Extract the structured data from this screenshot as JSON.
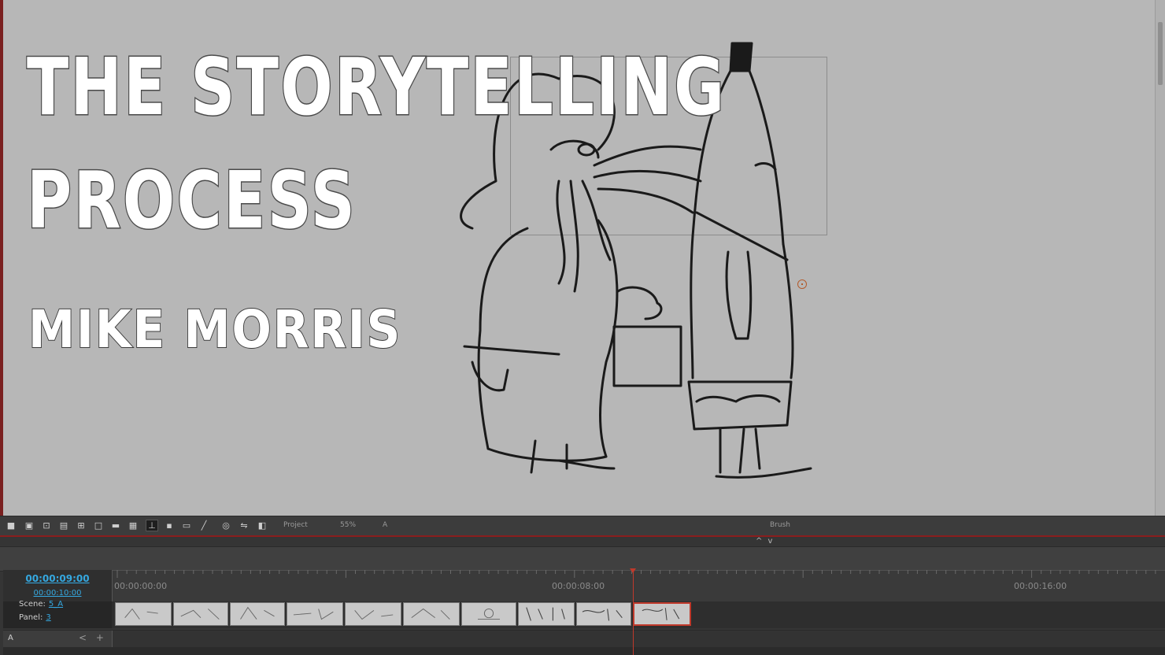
{
  "title": {
    "line1": "THE STORYTELLING",
    "line2": "PROCESS",
    "author": "MIKE MORRIS"
  },
  "toolbar": {
    "project_label": "Project",
    "zoom_label": "55%",
    "layer_label": "A",
    "tool_label": "Brush"
  },
  "timeline": {
    "current_time": "00:00:09:00",
    "total_time": "00:00:10:00",
    "ruler_labels": [
      "00:00:00:00",
      "00:00:08:00",
      "00:00:16:00"
    ],
    "scene_label": "Scene:",
    "scene_value": "5_A",
    "panel_label": "Panel:",
    "panel_value": "3",
    "layer_name": "A",
    "layer_nav": "< + >",
    "collapse": "^ v"
  },
  "colors": {
    "accent_time": "#35a8e0",
    "playhead": "#c0392b",
    "stage_bg": "#b7b7b7"
  }
}
